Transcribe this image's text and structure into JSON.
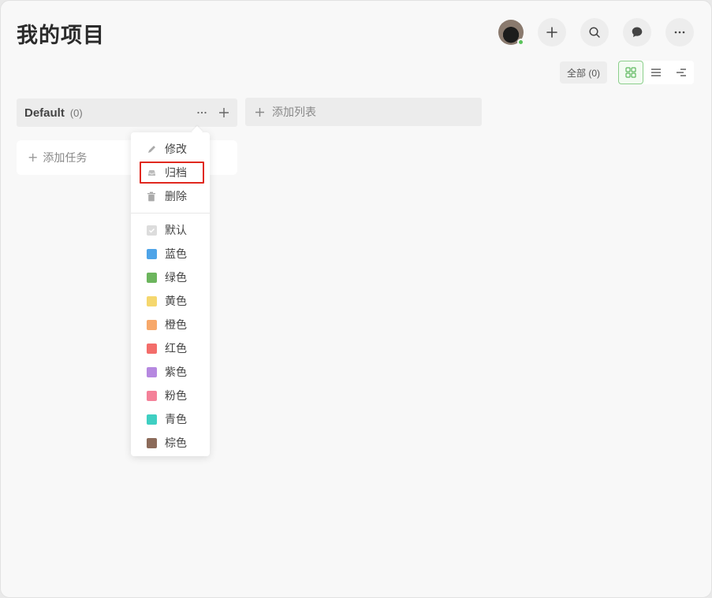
{
  "page": {
    "title": "我的项目"
  },
  "filter": {
    "label": "全部 (0)"
  },
  "column": {
    "title": "Default",
    "count": "(0)",
    "add_task_label": "添加任务"
  },
  "add_list": {
    "label": "添加列表"
  },
  "menu": {
    "actions": [
      {
        "label": "修改",
        "icon": "pencil-icon"
      },
      {
        "label": "归档",
        "icon": "archive-icon",
        "highlighted": true
      },
      {
        "label": "删除",
        "icon": "trash-icon"
      }
    ],
    "colors": [
      {
        "label": "默认",
        "color": "#dcdcdc"
      },
      {
        "label": "蓝色",
        "color": "#4ea4e8"
      },
      {
        "label": "绿色",
        "color": "#6cb55d"
      },
      {
        "label": "黄色",
        "color": "#f5d76e"
      },
      {
        "label": "橙色",
        "color": "#f7a86a"
      },
      {
        "label": "红色",
        "color": "#f36d6a"
      },
      {
        "label": "紫色",
        "color": "#b688e0"
      },
      {
        "label": "粉色",
        "color": "#f48199"
      },
      {
        "label": "青色",
        "color": "#3fcfc2"
      },
      {
        "label": "棕色",
        "color": "#8c6b5a"
      }
    ]
  },
  "colors": {
    "highlight": "#e0281f",
    "accent_green": "#59c35a"
  }
}
